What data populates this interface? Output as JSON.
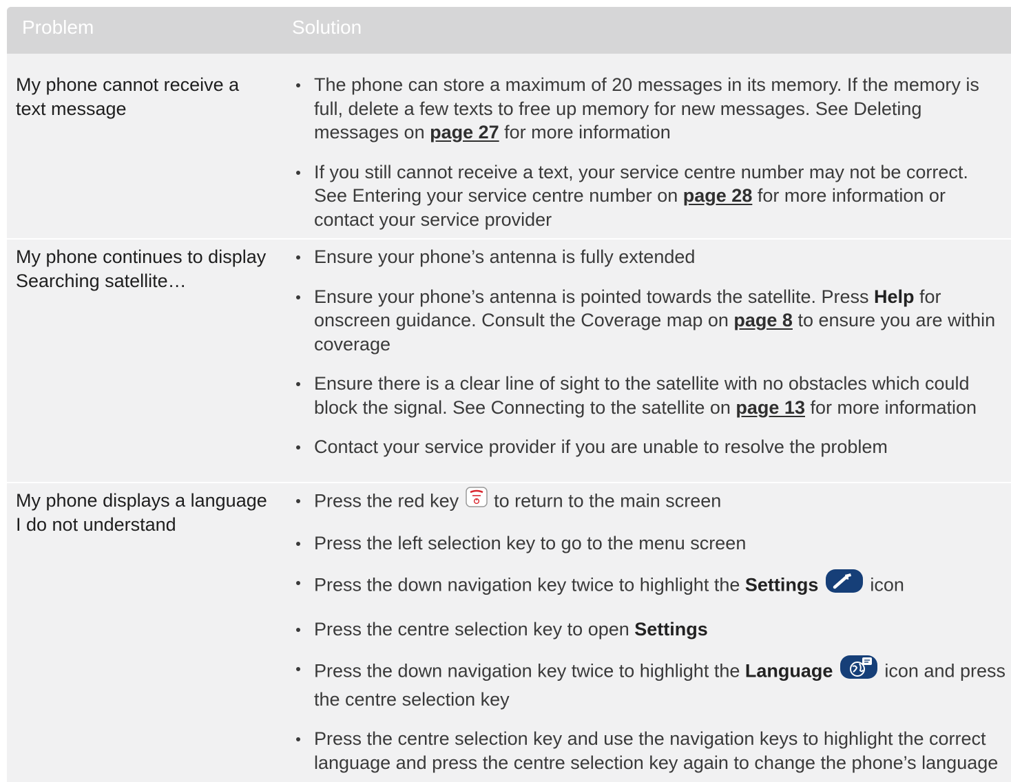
{
  "header": {
    "problem": "Problem",
    "solution": "Solution"
  },
  "rows": [
    {
      "problem": "My phone cannot receive a text message",
      "solutions": [
        {
          "pre": "The phone can store a maximum of 20 messages in its memory. If the memory is full, delete a few texts to free up memory for new messages. See Deleting messages on ",
          "link": "page 27",
          "post": " for more information"
        },
        {
          "pre": "If you still cannot receive a text, your service centre number may not be correct. See Entering your service centre number on ",
          "link": "page 28",
          "post": " for more information or contact your service provider"
        }
      ]
    },
    {
      "problem_pre": "My phone continues to display ",
      "problem_bold": "Searching satellite…",
      "solutions": [
        {
          "text": "Ensure your phone’s antenna is fully extended"
        },
        {
          "pre": "Ensure your phone’s antenna is pointed towards the satellite. Press ",
          "bold": "Help",
          "mid": " for onscreen guidance. Consult the Coverage map on ",
          "link": "page 8",
          "post": " to ensure you are within coverage"
        },
        {
          "pre": "Ensure there is a clear line of sight to the satellite with no obstacles which could block the signal. See Connecting to the satellite on ",
          "link": "page 13",
          "post": " for more information"
        },
        {
          "text": "Contact your service provider if you are unable to resolve the problem"
        }
      ]
    },
    {
      "problem": "My phone displays a language I do not understand",
      "solutions": [
        {
          "pre": "Press the red key ",
          "icon": "red-end-key-icon",
          "post": " to return to the main screen"
        },
        {
          "text": "Press the left selection key to go to the menu screen"
        },
        {
          "pre": "Press the down navigation key twice to highlight the ",
          "bold": "Settings",
          "icon": "settings-wrench-icon",
          "post": " icon"
        },
        {
          "pre": "Press the centre selection key to open ",
          "bold": "Settings"
        },
        {
          "pre": "Press the down navigation key twice to highlight the ",
          "bold": "Language",
          "icon": "language-globe-icon",
          "post": " icon and press the centre selection key"
        },
        {
          "text": "Press the centre selection key and use the navigation keys to highlight the correct language and press the centre selection key again to change the phone’s language"
        }
      ]
    }
  ],
  "colors": {
    "header_bg": "#d6d6d7",
    "body_bg": "#f1f1f2",
    "icon_blue": "#163f78",
    "red_key": "#d9262e"
  }
}
